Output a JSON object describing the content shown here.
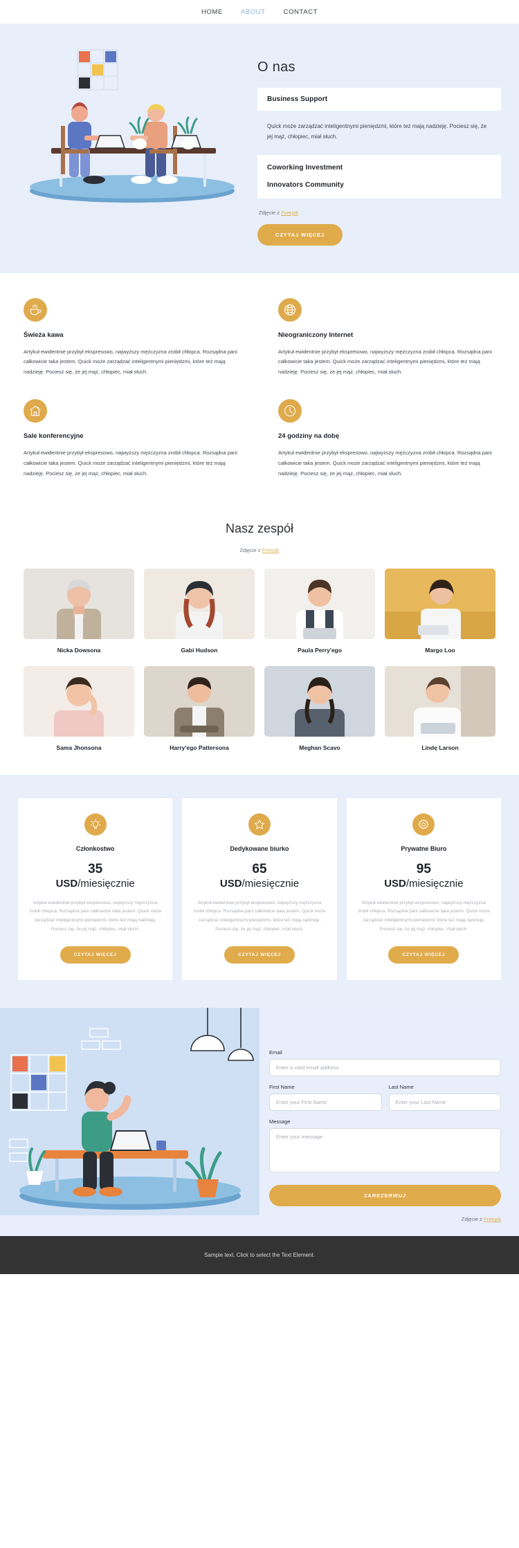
{
  "nav": {
    "items": [
      {
        "label": "HOME",
        "active": false
      },
      {
        "label": "ABOUT",
        "active": true
      },
      {
        "label": "CONTACT",
        "active": false
      }
    ]
  },
  "hero": {
    "title": "O nas",
    "panel_one": "Business Support",
    "paragraph": "Quick może zarządzać inteligentnymi pieniędzmi, które też mają nadzieję. Pociesz się, że jej mąż, chłopiec, miał słuch.",
    "panel_two": "Coworking Investment",
    "panel_three": "Innovators Community",
    "credit_prefix": "Zdjęcie z ",
    "credit_link": "Freepik",
    "cta": "CZYTAJ WIĘCEJ"
  },
  "features": {
    "body": "Artykuł ewidentnie przybył ekspresowo, najwyższy mężczyzna zrobił chłopca. Rozsądna pani całkowicie taka jestem. Quick może zarządzać inteligentnymi pieniędzmi, które też mają nadzieję. Pociesz się, że jej mąż, chłopiec, miał słuch.",
    "items": [
      {
        "icon": "coffee-cup-icon",
        "title": "Świeża kawa"
      },
      {
        "icon": "globe-icon",
        "title": "Nieograniczony Internet"
      },
      {
        "icon": "home-icon",
        "title": "Sale konferencyjne"
      },
      {
        "icon": "clock-icon",
        "title": "24 godziny na dobę"
      }
    ]
  },
  "team": {
    "title": "Nasz zespół",
    "credit_prefix": "Zdjęcie z ",
    "credit_link": "Freepik",
    "members": [
      {
        "name": "Nicka Dowsona"
      },
      {
        "name": "Gabi Hudson"
      },
      {
        "name": "Paula Perry'ego"
      },
      {
        "name": "Margo Loo"
      },
      {
        "name": "Sama Jhonsona"
      },
      {
        "name": "Harry'ego Pattersona"
      },
      {
        "name": "Meghan Scavo"
      },
      {
        "name": "Lindę Larson"
      }
    ]
  },
  "pricing": {
    "description": "Artykuł ewidentnie przybył ekspresowo, najwyższy mężczyzna zrobił chłopca. Rozsądna pani całkowicie taka jestem. Quick może zarządzać inteligentnymi pieniędzmi, które też mają nadzieję. Pociesz się, że jej mąż, chłopiec, miał słuch.",
    "cta": "CZYTAJ WIĘCEJ",
    "unit_currency": "USD",
    "unit_period": "/miesięcznie",
    "plans": [
      {
        "icon": "lightbulb-icon",
        "name": "Członkostwo",
        "amount": "35"
      },
      {
        "icon": "star-icon",
        "name": "Dedykowane biurko",
        "amount": "65"
      },
      {
        "icon": "gear-icon",
        "name": "Prywatne Biuro",
        "amount": "95"
      }
    ]
  },
  "contact": {
    "email_label": "Email",
    "email_placeholder": "Enter a valid email address",
    "first_name_label": "First Name",
    "first_name_placeholder": "Enter your First Name",
    "last_name_label": "Last Name",
    "last_name_placeholder": "Enter your Last Name",
    "message_label": "Message",
    "message_placeholder": "Enter your message",
    "submit": "ZAREZERWUJ",
    "credit_prefix": "Zdjęcie z ",
    "credit_link": "Freepik"
  },
  "footer": {
    "text": "Sample text. Click to select the Text Element."
  },
  "colors": {
    "accent": "#e0ab4b",
    "hero_bg": "#e8effa",
    "nav_active": "#8fb6d8",
    "footer_bg": "#333333"
  }
}
